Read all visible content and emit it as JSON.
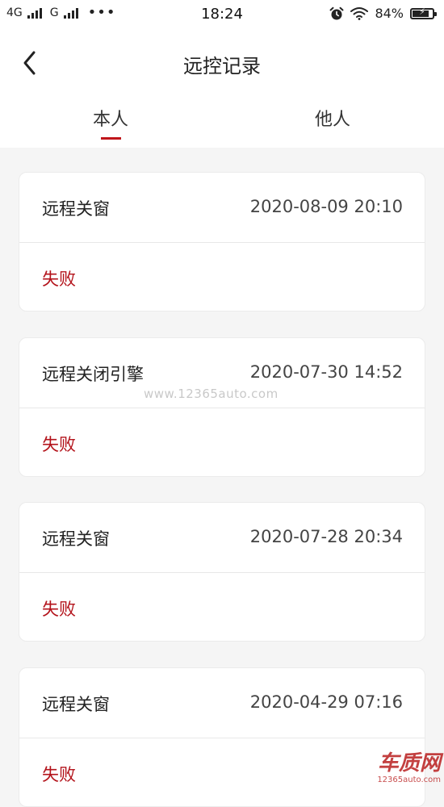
{
  "status_bar": {
    "network_1": "4G",
    "network_2": "G",
    "more": "•••",
    "time": "18:24",
    "battery_percent": "84%",
    "battery_level": 0.84
  },
  "header": {
    "title": "远控记录"
  },
  "tabs": [
    {
      "label": "本人",
      "active": true
    },
    {
      "label": "他人",
      "active": false
    }
  ],
  "records": [
    {
      "action": "远程关窗",
      "time": "2020-08-09 20:10",
      "status": "失败"
    },
    {
      "action": "远程关闭引擎",
      "time": "2020-07-30 14:52",
      "status": "失败"
    },
    {
      "action": "远程关窗",
      "time": "2020-07-28 20:34",
      "status": "失败"
    },
    {
      "action": "远程关窗",
      "time": "2020-04-29 07:16",
      "status": "失败"
    }
  ],
  "watermark": "www.12365auto.com",
  "logo": {
    "main": "车质网",
    "sub": "12365auto.com"
  },
  "colors": {
    "accent": "#c0161b",
    "status_fail": "#b3121a",
    "background": "#f5f5f5",
    "card": "#ffffff"
  },
  "icons": {
    "back": "chevron-left-icon",
    "alarm": "alarm-clock-icon",
    "wifi": "wifi-icon",
    "battery": "battery-charging-icon"
  }
}
